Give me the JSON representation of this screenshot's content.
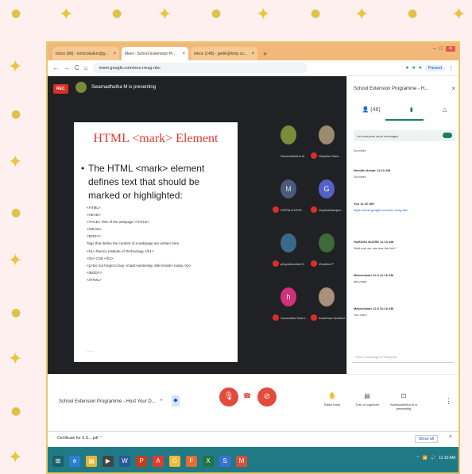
{
  "decorations": {
    "star_glyph": "✦",
    "dot_glyph": "●"
  },
  "browser": {
    "tabs": [
      {
        "label": "Inbox (88) - kmicrokalkm@g...",
        "close": "×"
      },
      {
        "label": "Meet - School Extension Pr...",
        "close": "×"
      },
      {
        "label": "Inbox (148) - gettik@kmp.co...",
        "close": "×"
      }
    ],
    "new_tab": "+",
    "window_controls": {
      "minimize": "–",
      "maximize": "□",
      "close": "×"
    },
    "nav": {
      "back": "←",
      "forward": "→",
      "reload": "C",
      "home": "⌂"
    },
    "url": "meet.google.com/nnz-rmzg-nbc",
    "paused_label": "Paused"
  },
  "meet": {
    "rec_label": "REC",
    "presenter_text": "Swarnadhutha M is presenting",
    "slide": {
      "title": "HTML <mark> Element",
      "bullet": "The HTML <mark> element defines text that should be marked or highlighted:",
      "code_lines": [
        "<HTML>",
        "<HEAD>",
        "<TITLE> Title of the webpage </TITLE>",
        "</HEAD>",
        "<BODY>",
        "Tags that define the content of a webpage are written here.",
        "<h1> Ramco Institute of Technology </h1>",
        "<h2> CSE </h2>",
        "<p>Do not forget to buy <mark>yesterday milk</mark> today.</p>",
        "</BODY>",
        "</HTML>"
      ],
      "footer": "———"
    },
    "participants": [
      {
        "name": "Swarnadhutha M",
        "color": "#7a8b3a"
      },
      {
        "name": "Gayathri Sank...",
        "color": "#9c8a70"
      },
      {
        "name": "GOPALA KRIS...",
        "color": "#4a5a7a",
        "initial": "M"
      },
      {
        "name": "Gopikasthanjan...",
        "color": "#5560c8",
        "initial": "G"
      },
      {
        "name": "pthyadharshini D",
        "color": "#3a6a8a"
      },
      {
        "name": "Vinothini P",
        "color": "#3f6a3a"
      },
      {
        "name": "Saranthika Sharn...",
        "color": "#d1307a",
        "initial": "h"
      },
      {
        "name": "Ananthaa Sesidevi",
        "color": "#a8907a"
      }
    ]
  },
  "panel": {
    "title": "School Extension Programme - H...",
    "close": "×",
    "tabs": [
      "👤 (48)",
      "▮",
      "△"
    ],
    "toggle_label": "Let everyone send messages",
    "messages": [
      {
        "who": "",
        "text": "Do meet"
      },
      {
        "who": "Hemithi Anwar  11:10 AM",
        "text": "Do meet"
      },
      {
        "who": "You  11:10 AM",
        "link": "https://meet.google.com/nnz-rmzg-nbc"
      },
      {
        "who": "HARSHU NUZRE  11:10 AM",
        "text": "Wait now we can see the link?"
      },
      {
        "who": "Maheshwari 12.6  11:16 AM",
        "text": "yes mam"
      },
      {
        "who": "Maheshwari 12.6  11:16 AM",
        "text": "Yes mam"
      }
    ],
    "send_placeholder": "Send a message to everyone"
  },
  "bottom": {
    "meeting_name": "School Extension Programme - Host Your D...",
    "chevron": "⌃",
    "mic_icon": "🎙",
    "end_icon": "☎",
    "cam_icon": "⊘",
    "raise_hand": "Raise hand",
    "captions": "Turn on captions",
    "presenting": "Swarnadhutha M is presenting",
    "more": "⋮"
  },
  "shelf": {
    "file": "Certificate for S.S....pdf  ⌃",
    "show_all": "Show all",
    "close": "×"
  },
  "taskbar": {
    "items": [
      "⊞",
      "e",
      "▤",
      "▶",
      "W",
      "P",
      "A",
      "G",
      "F",
      "X",
      "S",
      "M"
    ],
    "tray": [
      "⌃",
      "📶",
      "🔊",
      "11:10 AM"
    ]
  }
}
